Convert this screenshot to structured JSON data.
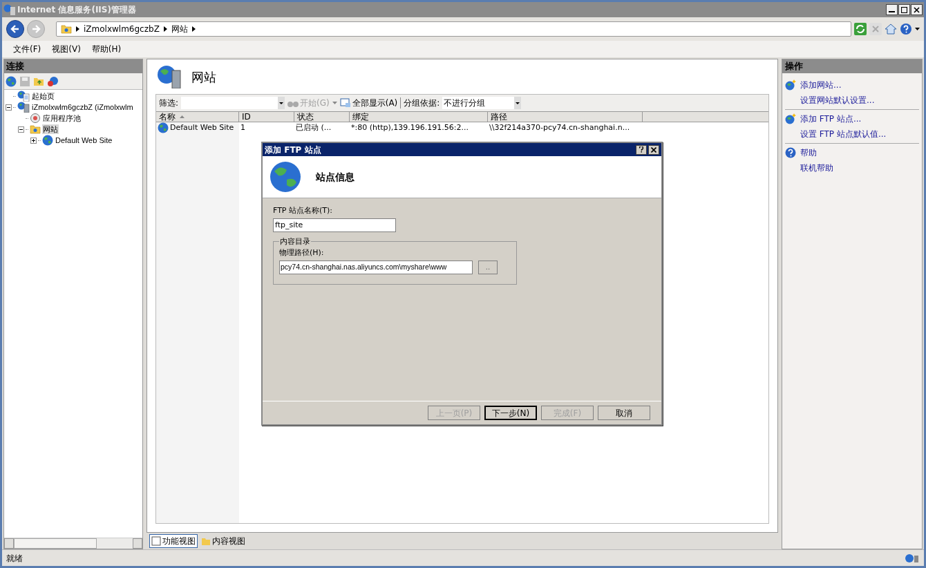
{
  "window": {
    "title": "Internet 信息服务(IIS)管理器"
  },
  "address_bar": {
    "crumbs": [
      "iZmolxwlm6gczbZ",
      "网站"
    ]
  },
  "menu": [
    "文件(F)",
    "视图(V)",
    "帮助(H)"
  ],
  "connections": {
    "title": "连接",
    "tree": [
      {
        "label": "起始页",
        "kind": "home",
        "selected": false
      },
      {
        "label": "iZmolxwlm6gczbZ (iZmolxwlm",
        "kind": "server",
        "selected": false,
        "expanded": true,
        "children": [
          {
            "label": "应用程序池",
            "kind": "pool",
            "selected": false
          },
          {
            "label": "网站",
            "kind": "folder",
            "selected": true,
            "expanded": true,
            "children": [
              {
                "label": "Default Web Site",
                "kind": "site",
                "selected": false,
                "expanded": false
              }
            ]
          }
        ]
      }
    ]
  },
  "content": {
    "heading": "网站",
    "toolbar": {
      "filter_label": "筛选:",
      "start": {
        "label": "开始(G)",
        "disabled": true
      },
      "show_all": "全部显示(A)",
      "group_label": "分组依据:",
      "group_value": "不进行分组"
    },
    "table": {
      "columns": [
        {
          "label": "名称",
          "sorted": true
        },
        {
          "label": "ID",
          "sorted": false
        },
        {
          "label": "状态",
          "sorted": false
        },
        {
          "label": "绑定",
          "sorted": false
        },
        {
          "label": "路径",
          "sorted": false
        }
      ],
      "rows": [
        [
          "Default Web Site",
          "1",
          "已启动 (...",
          "*:80 (http),139.196.191.56:2...",
          "\\\\32f214a370-pcy74.cn-shanghai.n..."
        ]
      ]
    },
    "views": [
      {
        "label": "功能视图",
        "selected": true
      },
      {
        "label": "内容视图",
        "selected": false
      }
    ]
  },
  "actions": {
    "title": "操作",
    "groups": [
      {
        "kind": "add",
        "items": [
          "添加网站...",
          "设置网站默认设置..."
        ]
      },
      {
        "kind": "add",
        "items": [
          "添加 FTP 站点...",
          "设置 FTP 站点默认值..."
        ]
      },
      {
        "kind": "help",
        "items": [
          "帮助",
          "联机帮助"
        ]
      }
    ]
  },
  "dialog": {
    "title": "添加 FTP 站点",
    "header": "站点信息",
    "name_label": "FTP 站点名称(T):",
    "name_value": "ftp_site",
    "group_label": "内容目录",
    "path_label": "物理路径(H):",
    "path_value": "pcy74.cn-shanghai.nas.aliyuncs.com\\myshare\\www",
    "browse": "..",
    "buttons": [
      {
        "label": "上一页(P)",
        "disabled": true,
        "default": false
      },
      {
        "label": "下一步(N)",
        "disabled": false,
        "default": true
      },
      {
        "label": "完成(F)",
        "disabled": true,
        "default": false
      },
      {
        "label": "取消",
        "disabled": false,
        "default": false
      }
    ]
  },
  "status_bar": {
    "text": "就绪"
  }
}
